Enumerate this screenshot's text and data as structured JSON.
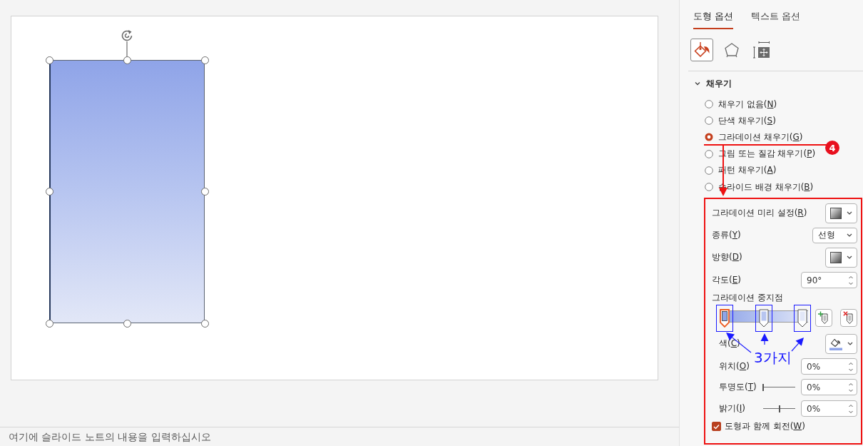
{
  "slide": {
    "shape": {
      "selected": true
    }
  },
  "notes": {
    "placeholder": "여기에 슬라이드 노트의 내용을 입력하십시오"
  },
  "format_pane": {
    "tabs": [
      {
        "label": "도형 옵션",
        "selected": true
      },
      {
        "label": "텍스트 옵션",
        "selected": false
      }
    ],
    "categories": [
      {
        "kind": "fill",
        "selected": true
      },
      {
        "kind": "effects",
        "selected": false
      },
      {
        "kind": "size",
        "selected": false
      }
    ],
    "section": {
      "title": "채우기",
      "expanded": true
    },
    "fill_options": [
      {
        "label": "채우기 없음(N)",
        "selected": false
      },
      {
        "label": "단색 채우기(S)",
        "selected": false
      },
      {
        "label": "그라데이션 채우기(G)",
        "selected": true
      },
      {
        "label": "그림 또는 질감 채우기(P)",
        "selected": false
      },
      {
        "label": "패턴 채우기(A)",
        "selected": false
      },
      {
        "label": "슬라이드 배경 채우기(B)",
        "selected": false
      }
    ],
    "gradient": {
      "preset": {
        "label": "그라데이션 미리 설정(R)"
      },
      "type": {
        "label": "종류(Y)",
        "value": "선형"
      },
      "direction": {
        "label": "방향(D)"
      },
      "angle": {
        "label": "각도(E)",
        "value": "90°"
      },
      "stops": {
        "label": "그라데이션 중지점",
        "items": [
          {
            "level": 0,
            "color": "#8fa4e8",
            "selected": true,
            "highlighted": true
          },
          {
            "level": 0.5,
            "color": "#b7c5f0",
            "selected": false,
            "highlighted": true
          },
          {
            "level": 1,
            "color": "#e2e7f7",
            "selected": false,
            "highlighted": true
          }
        ]
      },
      "color": {
        "label": "색(C)"
      },
      "position": {
        "label": "위치(O)",
        "value": "0%"
      },
      "transparency": {
        "label": "투명도(T)",
        "value": "0%",
        "level": 0
      },
      "brightness": {
        "label": "밝기(I)",
        "value": "0%",
        "level": 0.5
      },
      "rotate_with_shape": {
        "label": "도형과 함께 회전(W)",
        "checked": true
      }
    }
  },
  "annotations": {
    "badge": "4",
    "callout": "3가지"
  }
}
